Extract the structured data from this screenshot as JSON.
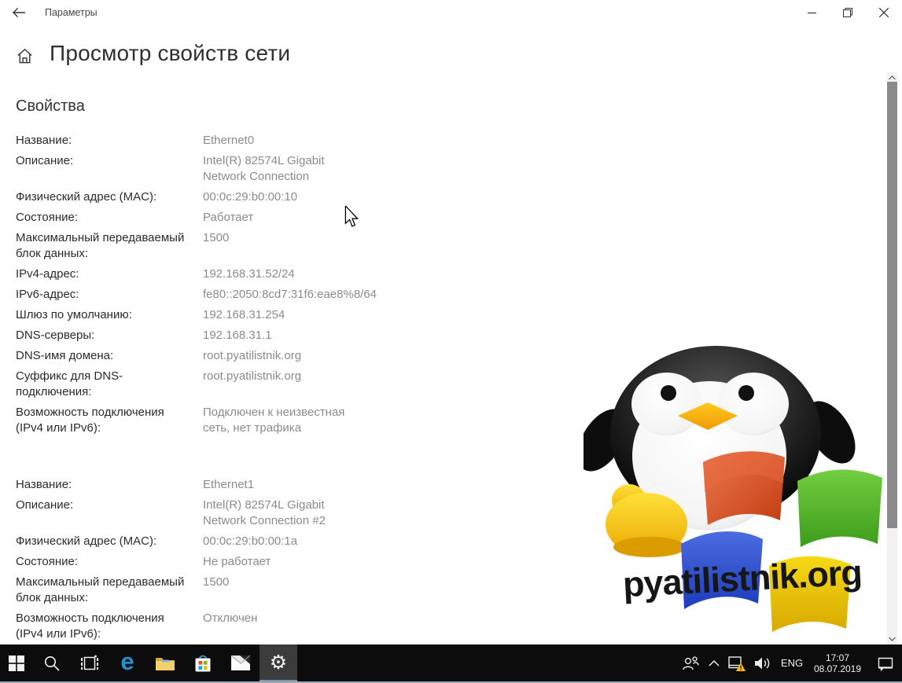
{
  "window": {
    "app_title": "Параметры",
    "controls": {
      "minimize": "minimize",
      "restore": "restore",
      "close": "close"
    }
  },
  "page": {
    "title": "Просмотр свойств сети",
    "section_title": "Свойства"
  },
  "adapters": [
    {
      "rows": [
        {
          "label": "Название:",
          "value": "Ethernet0"
        },
        {
          "label": "Описание:",
          "value": "Intel(R) 82574L Gigabit\nNetwork Connection"
        },
        {
          "label": "Физический адрес (MAC):",
          "value": "00:0c:29:b0:00:10"
        },
        {
          "label": "Состояние:",
          "value": "Работает"
        },
        {
          "label": "Максимальный передаваемый\nблок данных:",
          "value": "1500"
        },
        {
          "label": "IPv4-адрес:",
          "value": "192.168.31.52/24"
        },
        {
          "label": "IPv6-адрес:",
          "value": "fe80::2050:8cd7:31f6:eae8%8/64"
        },
        {
          "label": "Шлюз по умолчанию:",
          "value": "192.168.31.254"
        },
        {
          "label": "DNS-серверы:",
          "value": "192.168.31.1"
        },
        {
          "label": "DNS-имя домена:",
          "value": "root.pyatilistnik.org"
        },
        {
          "label": "Суффикс для DNS-\nподключения:",
          "value": "root.pyatilistnik.org"
        },
        {
          "label": "Возможность подключения\n(IPv4 или IPv6):",
          "value": "Подключен к неизвестная\nсеть, нет трафика"
        }
      ]
    },
    {
      "rows": [
        {
          "label": "Название:",
          "value": "Ethernet1"
        },
        {
          "label": "Описание:",
          "value": "Intel(R) 82574L Gigabit\nNetwork Connection #2"
        },
        {
          "label": "Физический адрес (MAC):",
          "value": "00:0c:29:b0:00:1a"
        },
        {
          "label": "Состояние:",
          "value": "Не работает"
        },
        {
          "label": "Максимальный передаваемый\nблок данных:",
          "value": "1500"
        },
        {
          "label": "Возможность подключения\n(IPv4 или IPv6):",
          "value": "Отключен"
        }
      ]
    }
  ],
  "watermark": {
    "text": "pyatilistnik.org"
  },
  "taskbar": {
    "app_icons": [
      "start-icon",
      "search-icon",
      "task-view-icon",
      "edge-icon",
      "file-explorer-icon",
      "store-icon",
      "mail-icon",
      "settings-icon"
    ],
    "active_app": "settings",
    "edge_letter": "e",
    "gear_glyph": "⚙",
    "tray": {
      "icons": [
        "people-icon",
        "chevron-up-icon",
        "network-warning-icon",
        "speaker-icon"
      ],
      "language": "ENG",
      "time": "17:07",
      "date": "08.07.2019"
    }
  },
  "colors": {
    "taskbar_bg": "#0c0c0c",
    "active_app_bg": "#3c3c3c",
    "active_underline": "#7a97ad",
    "value_text": "#8b8b8b",
    "label_text": "#2b2b2b",
    "scroll_thumb": "#8b8b8b",
    "ms_red": "#f25022",
    "ms_green": "#7fba00",
    "ms_blue": "#00a4ef",
    "ms_yellow": "#ffb900",
    "warning_yellow": "#fdb913"
  }
}
